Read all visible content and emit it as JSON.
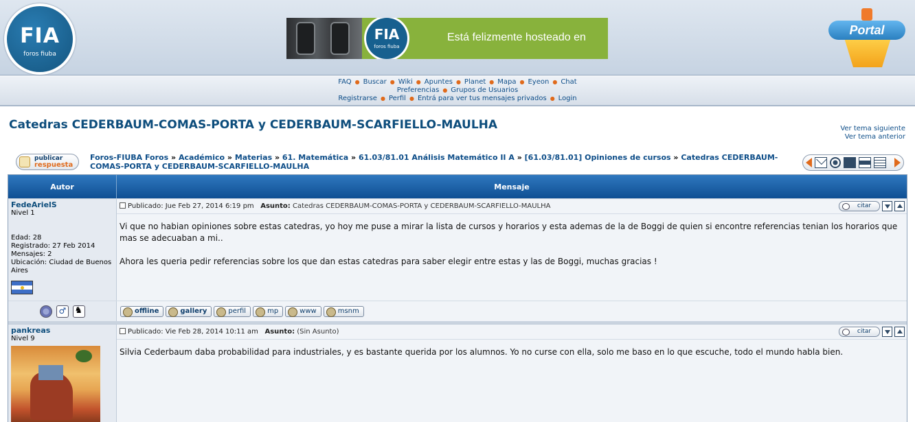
{
  "header": {
    "site_logo_text": "FIA",
    "site_logo_sub": "foros fiuba",
    "banner_logo_text": "FIA",
    "banner_logo_sub": "foros fiuba",
    "banner_text": "Está felizmente hosteado en",
    "portal_logo_text": "Portal"
  },
  "nav": {
    "row1": [
      "FAQ",
      "Buscar",
      "Wiki",
      "Apuntes",
      "Planet",
      "Mapa",
      "Eyeon",
      "Chat"
    ],
    "row2": [
      "Preferencias",
      "Grupos de Usuarios"
    ],
    "row3": [
      "Registrarse",
      "Perfil",
      "Entrá para ver tus mensajes privados",
      "Login"
    ]
  },
  "topic": {
    "title": "Catedras CEDERBAUM-COMAS-PORTA y CEDERBAUM-SCARFIELLO-MAULHA",
    "next_topic": "Ver tema siguiente",
    "prev_topic": "Ver tema anterior",
    "reply_label_top": "publicar",
    "reply_label_bottom": "respuesta",
    "breadcrumb": [
      "Foros-FIUBA Foros",
      "Académico",
      "Materias",
      "61. Matemática",
      "61.03/81.01 Análisis Matemático II A",
      "[61.03/81.01] Opiniones de cursos",
      "Catedras CEDERBAUM-COMAS-PORTA y CEDERBAUM-SCARFIELLO-MAULHA"
    ],
    "breadcrumb_sep": "»"
  },
  "table": {
    "col_author": "Autor",
    "col_message": "Mensaje"
  },
  "posts": [
    {
      "username": "FedeArielS",
      "rank": "Nivel 1",
      "age": "Edad: 28",
      "registered": "Registrado: 27 Feb 2014",
      "messages": "Mensajes: 2",
      "location": "Ubicación: Ciudad de Buenos Aires",
      "published": "Publicado: Jue Feb 27, 2014 6:19 pm",
      "subject_label": "Asunto:",
      "subject": "Catedras CEDERBAUM-COMAS-PORTA y CEDERBAUM-SCARFIELLO-MAULHA",
      "quote_label": "citar",
      "paragraph1": "Vi que no habian opiniones sobre estas catedras, yo hoy me puse a mirar la lista de cursos y horarios y esta ademas de la de Boggi de quien si encontre referencias tenian los horarios que mas se adecuaban a mi..",
      "paragraph2": "Ahora les queria pedir referencias sobre los que dan estas catedras para saber elegir entre estas y las de Boggi, muchas gracias !",
      "buttons": [
        "offline",
        "gallery",
        "perfil",
        "mp",
        "www",
        "msnm"
      ]
    },
    {
      "username": "pankreas",
      "rank": "Nivel 9",
      "published": "Publicado: Vie Feb 28, 2014 10:11 am",
      "subject_label": "Asunto:",
      "subject": "(Sin Asunto)",
      "quote_label": "citar",
      "paragraph1": "Silvia Cederbaum daba probabilidad para industriales, y es bastante querida por los alumnos. Yo no curse con ella, solo me baso en lo que escuche, todo el mundo habla bien."
    }
  ],
  "colors": {
    "table_header": "#0f4f93",
    "link": "#0d4d88",
    "accent": "#e06a1b",
    "banner_green": "#88b23c"
  }
}
